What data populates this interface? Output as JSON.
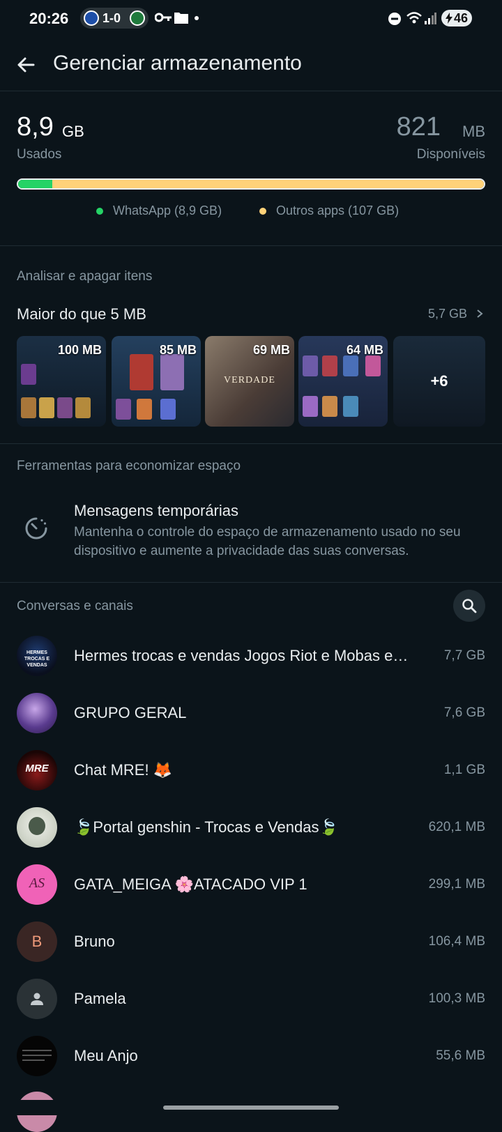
{
  "status_bar": {
    "time": "20:26",
    "score": "1-0",
    "battery": "46"
  },
  "header": {
    "title": "Gerenciar armazenamento"
  },
  "storage": {
    "used_value": "8,9",
    "used_unit": "GB",
    "used_label": "Usados",
    "free_value": "821",
    "free_unit": "MB",
    "free_label": "Disponíveis",
    "whatsapp_fraction": 0.074,
    "legend": [
      {
        "label": "WhatsApp (8,9 GB)",
        "color": "#25d366"
      },
      {
        "label": "Outros apps (107 GB)",
        "color": "#ffd279"
      }
    ]
  },
  "review": {
    "heading": "Analisar e apagar itens",
    "large_files_title": "Maior do que 5 MB",
    "large_files_size": "5,7 GB",
    "thumbnails": [
      {
        "size": "100 MB"
      },
      {
        "size": "85 MB"
      },
      {
        "size": "69 MB",
        "text": "VERDADE"
      },
      {
        "size": "64 MB"
      },
      {
        "more": "+6"
      }
    ]
  },
  "tools": {
    "heading": "Ferramentas para economizar espaço",
    "items": [
      {
        "title": "Mensagens temporárias",
        "description": "Mantenha o controle do espaço de armazenamento usado no seu dispositivo e aumente a privacidade das suas conversas."
      }
    ]
  },
  "chats": {
    "heading": "Conversas e canais",
    "items": [
      {
        "name": "Hermes trocas e vendas Jogos Riot e Mobas e…",
        "size": "7,7 GB",
        "avatar_text": "HERMES TROCAS E VENDAS"
      },
      {
        "name": "GRUPO GERAL",
        "size": "7,6 GB"
      },
      {
        "name": "Chat MRE! 🦊",
        "size": "1,1 GB",
        "avatar_text": "MRE"
      },
      {
        "name": "🍃Portal genshin - Trocas e Vendas🍃",
        "size": "620,1 MB"
      },
      {
        "name": "GATA_MEIGA 🌸ATACADO VIP 1",
        "size": "299,1 MB",
        "avatar_text": "AS"
      },
      {
        "name": "Bruno",
        "size": "106,4 MB",
        "avatar_letter": "B"
      },
      {
        "name": "Pamela",
        "size": "100,3 MB"
      },
      {
        "name": "Meu Anjo",
        "size": "55,6 MB"
      }
    ]
  }
}
